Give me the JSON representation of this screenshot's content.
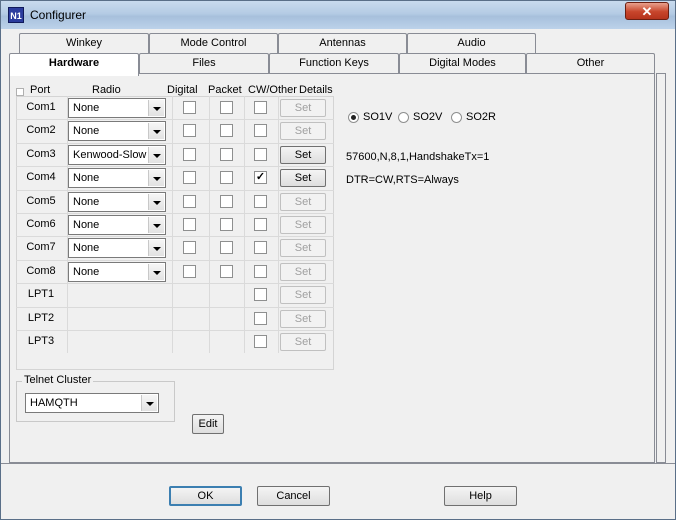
{
  "window": {
    "title": "Configurer",
    "close_label": "✕"
  },
  "tabs_row1": [
    "Winkey",
    "Mode Control",
    "Antennas",
    "Audio"
  ],
  "tabs_row2": [
    "Hardware",
    "Files",
    "Function Keys",
    "Digital Modes",
    "Other"
  ],
  "active_tab": "Hardware",
  "headers": {
    "port": "Port",
    "radio": "Radio",
    "digital": "Digital",
    "packet": "Packet",
    "cw_other": "CW/Other",
    "details": "Details"
  },
  "so_options": [
    {
      "label": "SO1V",
      "selected": true
    },
    {
      "label": "SO2V",
      "selected": false
    },
    {
      "label": "SO2R",
      "selected": false
    }
  ],
  "ports": [
    {
      "port": "Com1",
      "radio": "None",
      "digital": false,
      "packet": false,
      "cw": false,
      "set_label": "Set",
      "set_enabled": false,
      "detail": ""
    },
    {
      "port": "Com2",
      "radio": "None",
      "digital": false,
      "packet": false,
      "cw": false,
      "set_label": "Set",
      "set_enabled": false,
      "detail": ""
    },
    {
      "port": "Com3",
      "radio": "Kenwood-Slow",
      "digital": false,
      "packet": false,
      "cw": false,
      "set_label": "Set",
      "set_enabled": true,
      "detail": "57600,N,8,1,HandshakeTx=1"
    },
    {
      "port": "Com4",
      "radio": "None",
      "digital": false,
      "packet": false,
      "cw": true,
      "set_label": "Set",
      "set_enabled": true,
      "detail": "DTR=CW,RTS=Always"
    },
    {
      "port": "Com5",
      "radio": "None",
      "digital": false,
      "packet": false,
      "cw": false,
      "set_label": "Set",
      "set_enabled": false,
      "detail": ""
    },
    {
      "port": "Com6",
      "radio": "None",
      "digital": false,
      "packet": false,
      "cw": false,
      "set_label": "Set",
      "set_enabled": false,
      "detail": ""
    },
    {
      "port": "Com7",
      "radio": "None",
      "digital": false,
      "packet": false,
      "cw": false,
      "set_label": "Set",
      "set_enabled": false,
      "detail": ""
    },
    {
      "port": "Com8",
      "radio": "None",
      "digital": false,
      "packet": false,
      "cw": false,
      "set_label": "Set",
      "set_enabled": false,
      "detail": ""
    }
  ],
  "lpt_ports": [
    {
      "port": "LPT1",
      "cw": false,
      "set_label": "Set"
    },
    {
      "port": "LPT2",
      "cw": false,
      "set_label": "Set"
    },
    {
      "port": "LPT3",
      "cw": false,
      "set_label": "Set"
    }
  ],
  "telnet": {
    "legend": "Telnet Cluster",
    "value": "HAMQTH",
    "edit_label": "Edit"
  },
  "buttons": {
    "ok": "OK",
    "cancel": "Cancel",
    "help": "Help"
  },
  "app_icon_text": "N1"
}
